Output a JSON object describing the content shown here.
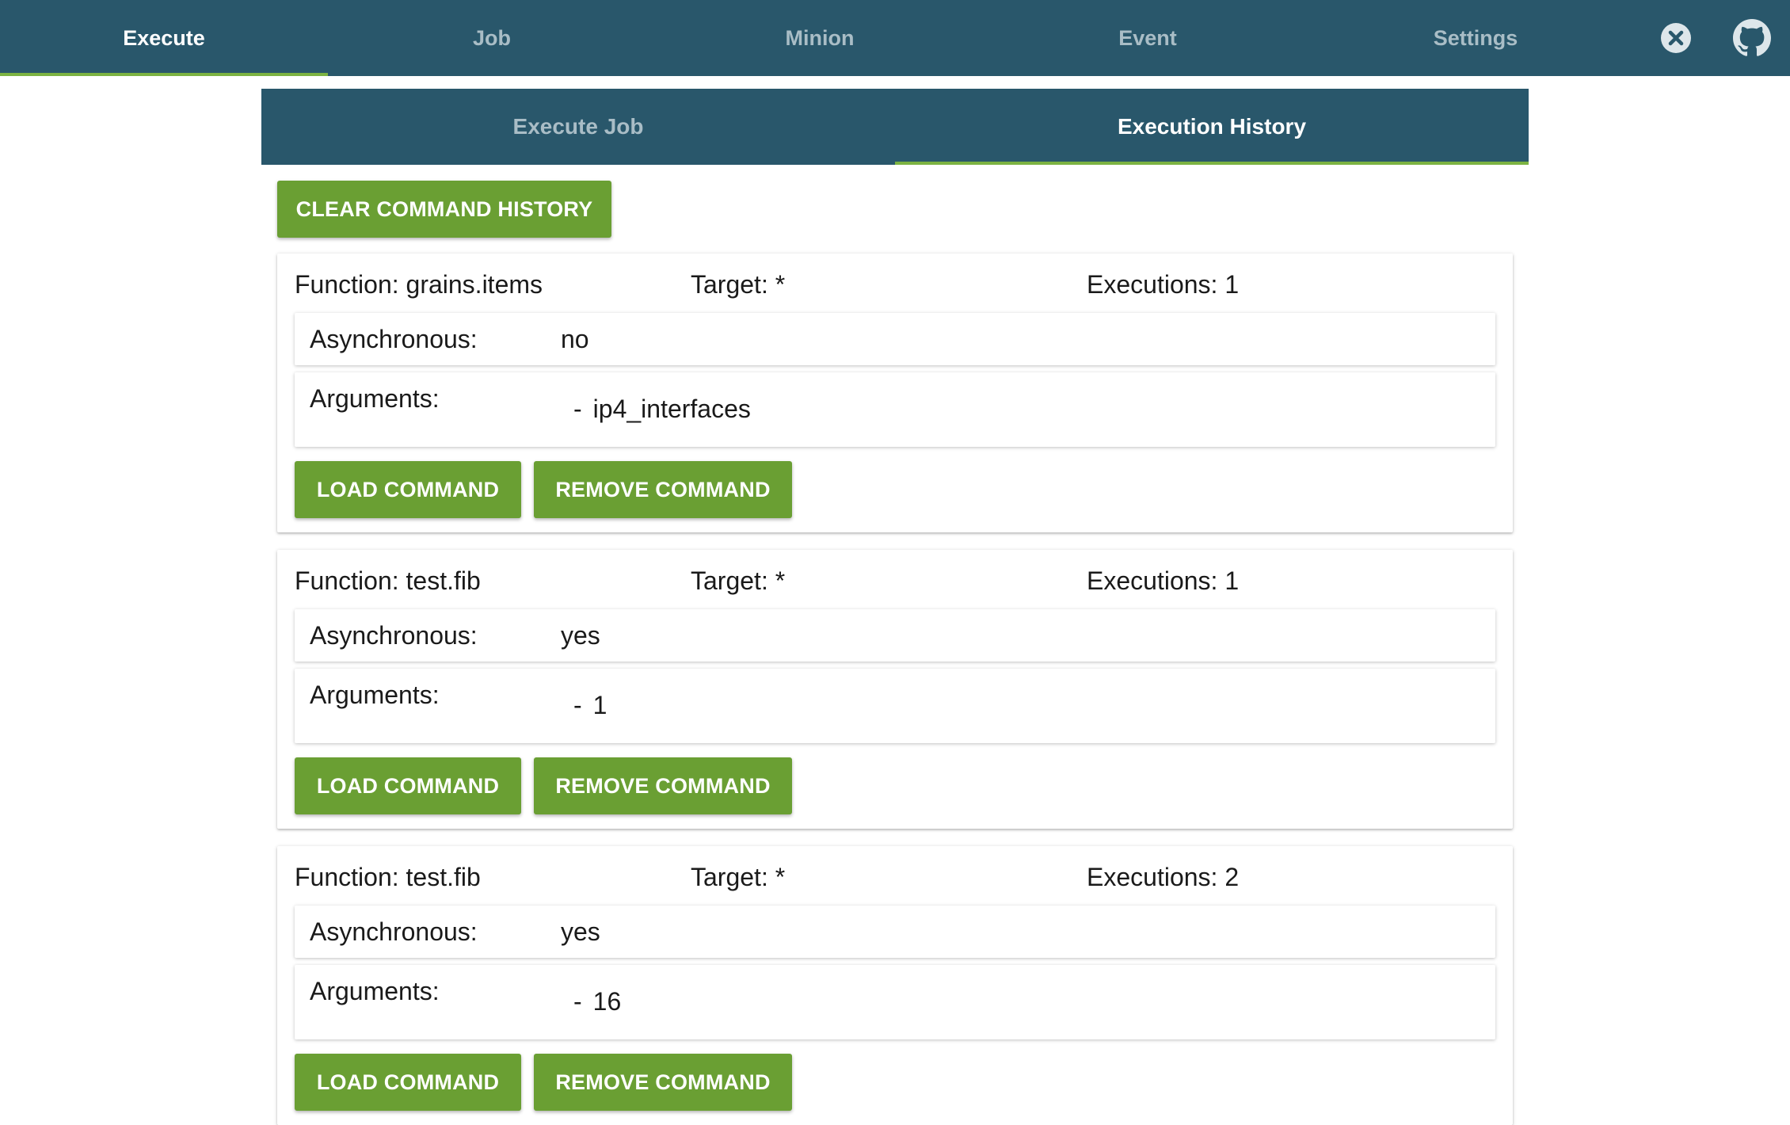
{
  "nav": {
    "tabs": [
      {
        "label": "Execute",
        "active": true
      },
      {
        "label": "Job",
        "active": false
      },
      {
        "label": "Minion",
        "active": false
      },
      {
        "label": "Event",
        "active": false
      },
      {
        "label": "Settings",
        "active": false
      }
    ],
    "icons": [
      "close-circle-icon",
      "github-icon"
    ]
  },
  "subnav": {
    "tabs": [
      {
        "label": "Execute Job",
        "active": false
      },
      {
        "label": "Execution History",
        "active": true
      }
    ]
  },
  "actions": {
    "clear_label": "CLEAR COMMAND HISTORY"
  },
  "history": [
    {
      "function": "Function: grains.items",
      "target": "Target: *",
      "executions": "Executions: 1",
      "async_label": "Asynchronous:",
      "async_value": "no",
      "args_label": "Arguments:",
      "args": [
        "ip4_interfaces"
      ],
      "load_label": "LOAD COMMAND",
      "remove_label": "REMOVE COMMAND"
    },
    {
      "function": "Function: test.fib",
      "target": "Target: *",
      "executions": "Executions: 1",
      "async_label": "Asynchronous:",
      "async_value": "yes",
      "args_label": "Arguments:",
      "args": [
        "1"
      ],
      "load_label": "LOAD COMMAND",
      "remove_label": "REMOVE COMMAND"
    },
    {
      "function": "Function: test.fib",
      "target": "Target: *",
      "executions": "Executions: 2",
      "async_label": "Asynchronous:",
      "async_value": "yes",
      "args_label": "Arguments:",
      "args": [
        "16"
      ],
      "load_label": "LOAD COMMAND",
      "remove_label": "REMOVE COMMAND"
    }
  ],
  "colors": {
    "nav_bg": "#29576b",
    "accent": "#7cb342",
    "button": "#6a9f33"
  }
}
